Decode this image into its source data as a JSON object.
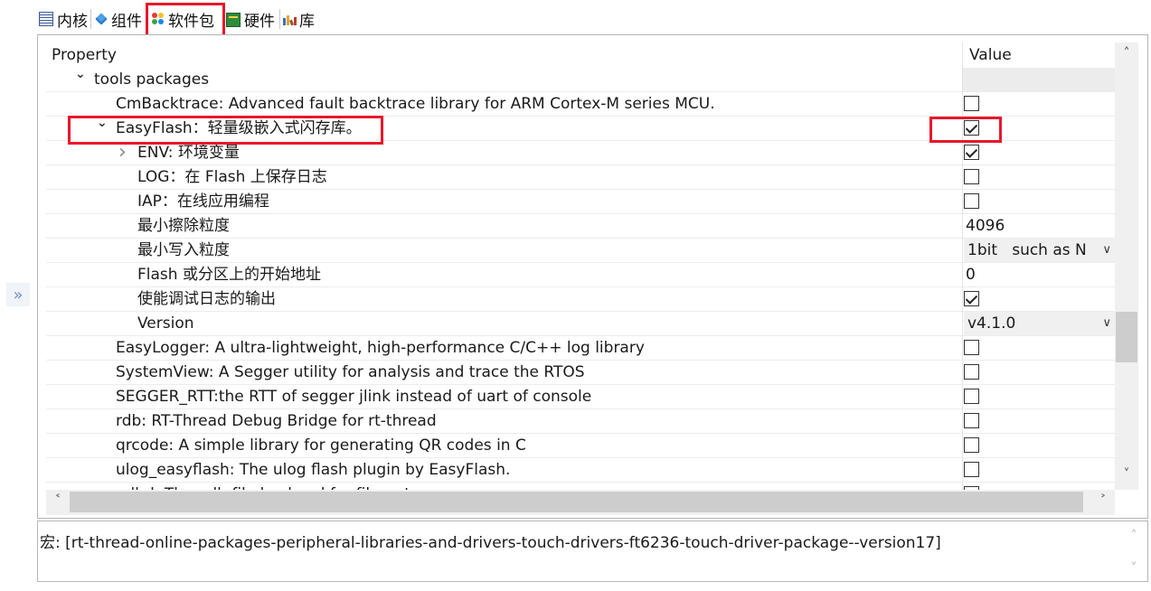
{
  "tabs": [
    {
      "label": "内核",
      "icon": "kernel-icon"
    },
    {
      "label": "组件",
      "icon": "component-icon"
    },
    {
      "label": "软件包",
      "icon": "package-icon"
    },
    {
      "label": "硬件",
      "icon": "hardware-icon"
    },
    {
      "label": "库",
      "icon": "library-icon"
    }
  ],
  "panel": {
    "expand_glyph": "»"
  },
  "table": {
    "header_property": "Property",
    "header_value": "Value",
    "rows": [
      {
        "label": "tools packages",
        "indent": 1,
        "expander": "expanded",
        "value_type": "none",
        "value": ""
      },
      {
        "label": "CmBacktrace: Advanced fault backtrace library for ARM Cortex-M series MCU.",
        "indent": 2,
        "expander": "",
        "value_type": "checkbox",
        "checked": false
      },
      {
        "label": "EasyFlash：轻量级嵌入式闪存库。",
        "indent": 2,
        "expander": "expanded",
        "value_type": "checkbox",
        "checked": true
      },
      {
        "label": "ENV: 环境变量",
        "indent": 3,
        "expander": "collapsed",
        "value_type": "checkbox",
        "checked": true
      },
      {
        "label": "LOG：在 Flash 上保存日志",
        "indent": 3,
        "expander": "",
        "value_type": "checkbox",
        "checked": false
      },
      {
        "label": "IAP：在线应用编程",
        "indent": 3,
        "expander": "",
        "value_type": "checkbox",
        "checked": false
      },
      {
        "label": "最小擦除粒度",
        "indent": 3,
        "expander": "",
        "value_type": "text",
        "value": "4096"
      },
      {
        "label": "最小写入粒度",
        "indent": 3,
        "expander": "",
        "value_type": "combo",
        "value": "1bit   such as N"
      },
      {
        "label": "Flash 或分区上的开始地址",
        "indent": 3,
        "expander": "",
        "value_type": "text",
        "value": "0"
      },
      {
        "label": "使能调试日志的输出",
        "indent": 3,
        "expander": "",
        "value_type": "checkbox",
        "checked": true
      },
      {
        "label": "Version",
        "indent": 3,
        "expander": "",
        "value_type": "combo",
        "value": "v4.1.0"
      },
      {
        "label": "EasyLogger: A ultra-lightweight, high-performance C/C++ log library",
        "indent": 2,
        "expander": "",
        "value_type": "checkbox",
        "checked": false
      },
      {
        "label": "SystemView: A Segger utility for analysis and trace the RTOS",
        "indent": 2,
        "expander": "",
        "value_type": "checkbox",
        "checked": false
      },
      {
        "label": "SEGGER_RTT:the RTT of segger jlink instead of uart of console",
        "indent": 2,
        "expander": "",
        "value_type": "checkbox",
        "checked": false
      },
      {
        "label": "rdb: RT-Thread Debug Bridge for rt-thread",
        "indent": 2,
        "expander": "",
        "value_type": "checkbox",
        "checked": false
      },
      {
        "label": "qrcode: A simple library for generating QR codes in C",
        "indent": 2,
        "expander": "",
        "value_type": "checkbox",
        "checked": false
      },
      {
        "label": "ulog_easyflash: The ulog flash plugin by EasyFlash.",
        "indent": 2,
        "expander": "",
        "value_type": "checkbox",
        "checked": false
      },
      {
        "label": "adbd: The adb file backend for filesystem",
        "indent": 2,
        "expander": "",
        "value_type": "checkbox",
        "checked": false
      }
    ]
  },
  "description": "宏: [rt-thread-online-packages-peripheral-libraries-and-drivers-touch-drivers-ft6236-touch-driver-package--version17]",
  "colors": {
    "highlight": "#e8172b",
    "combo_bg": "#f0f0f0",
    "scrollbar_thumb": "#cdcdcd"
  }
}
